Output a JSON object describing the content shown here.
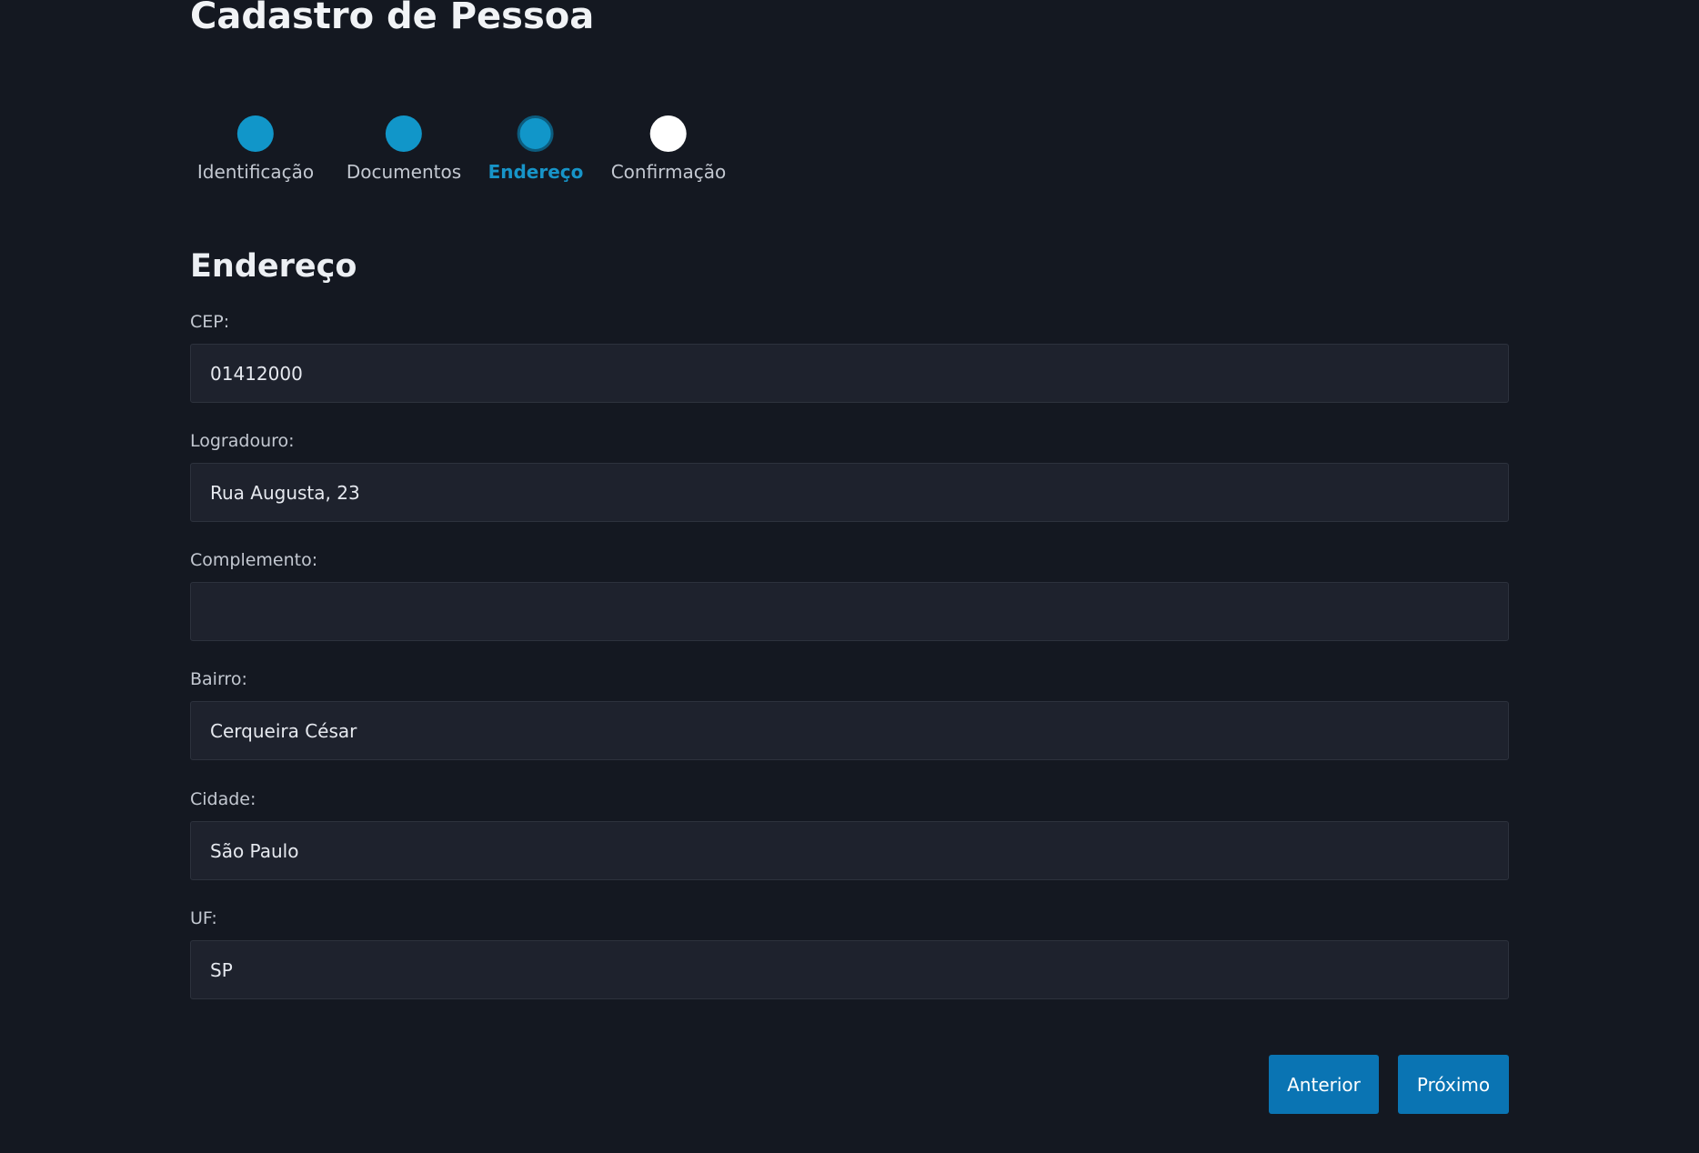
{
  "page_title": "Cadastro de Pessoa",
  "stepper": {
    "steps": [
      {
        "label": "Identificação",
        "state": "completed"
      },
      {
        "label": "Documentos",
        "state": "completed"
      },
      {
        "label": "Endereço",
        "state": "active"
      },
      {
        "label": "Confirmação",
        "state": "pending"
      }
    ]
  },
  "section_title": "Endereço",
  "form": {
    "cep": {
      "label": "CEP:",
      "value": "01412000"
    },
    "logradouro": {
      "label": "Logradouro:",
      "value": "Rua Augusta, 23"
    },
    "complemento": {
      "label": "Complemento:",
      "value": ""
    },
    "bairro": {
      "label": "Bairro:",
      "value": "Cerqueira César"
    },
    "cidade": {
      "label": "Cidade:",
      "value": "São Paulo"
    },
    "uf": {
      "label": "UF:",
      "value": "SP"
    }
  },
  "buttons": {
    "previous": "Anterior",
    "next": "Próximo"
  },
  "colors": {
    "background": "#141821",
    "accent": "#1196c9",
    "button": "#0a74b3",
    "input_background": "#1e222d"
  }
}
